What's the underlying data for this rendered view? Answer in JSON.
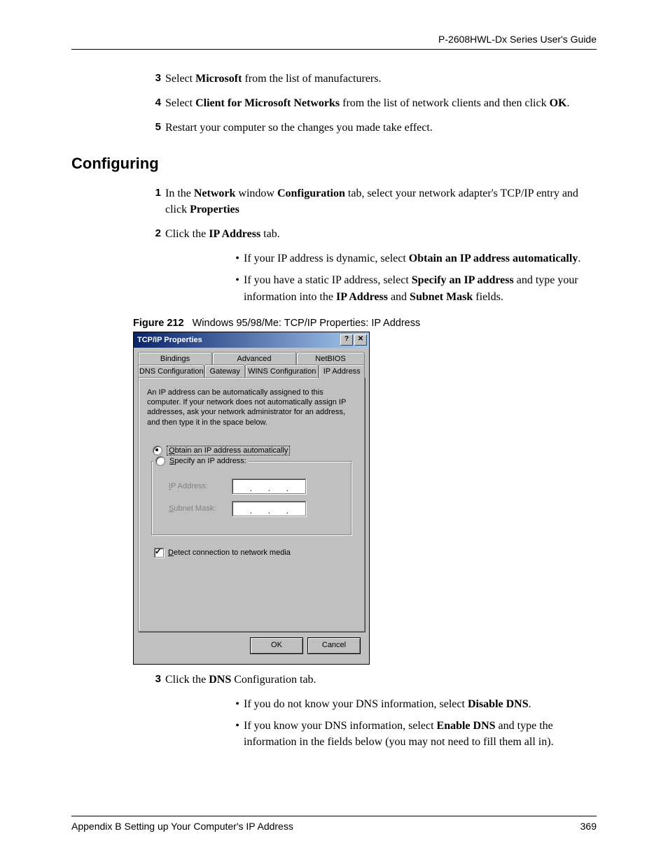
{
  "header": {
    "guide_title": "P-2608HWL-Dx Series User's Guide"
  },
  "steps_top": {
    "s3": {
      "num": "3",
      "pre": "Select ",
      "b1": "Microsoft",
      "post": " from the list of manufacturers."
    },
    "s4": {
      "num": "4",
      "pre": "Select ",
      "b1": "Client for Microsoft Networks",
      "mid": " from the list of network clients and then click ",
      "b2": "OK",
      "post": "."
    },
    "s5": {
      "num": "5",
      "text": "Restart your computer so the changes you made take effect."
    }
  },
  "section_title": "Configuring",
  "steps_cfg": {
    "s1": {
      "num": "1",
      "pre": "In the ",
      "b1": "Network",
      "mid1": " window ",
      "b2": "Configuration",
      "mid2": " tab, select your network adapter's TCP/IP entry and click ",
      "b3": "Properties"
    },
    "s2": {
      "num": "2",
      "pre": "Click the ",
      "b1": "IP Address",
      "post": " tab."
    },
    "s3": {
      "num": "3",
      "pre": "Click the ",
      "b1": "DNS",
      "post": " Configuration tab."
    }
  },
  "bullets1": {
    "b1": {
      "pre": "If your IP address is dynamic, select ",
      "bold": "Obtain an IP address automatically",
      "post": "."
    },
    "b2": {
      "pre": "If you have a static IP address, select ",
      "bold1": "Specify an IP address",
      "mid": " and type your information into the ",
      "bold2": "IP Address",
      "mid2": " and ",
      "bold3": "Subnet Mask",
      "post": " fields."
    }
  },
  "bullets2": {
    "b1": {
      "pre": "If you do not know your DNS information, select ",
      "bold": "Disable DNS",
      "post": "."
    },
    "b2": {
      "pre": "If you know your DNS information, select ",
      "bold": "Enable DNS",
      "post": " and type the information in the fields below (you may not need to fill them all in)."
    }
  },
  "figure": {
    "label": "Figure 212",
    "caption": "Windows 95/98/Me: TCP/IP Properties: IP Address"
  },
  "dialog": {
    "title": "TCP/IP Properties",
    "help_btn": "?",
    "close_btn": "✕",
    "tabs_row1": {
      "bindings": "Bindings",
      "advanced": "Advanced",
      "netbios": "NetBIOS"
    },
    "tabs_row2": {
      "dns": "DNS Configuration",
      "gateway": "Gateway",
      "wins": "WINS Configuration",
      "ip": "IP Address"
    },
    "desc": "An IP address can be automatically assigned to this computer. If your network does not automatically assign IP addresses, ask your network administrator for an address, and then type it in the space below.",
    "radio_auto_pre": "O",
    "radio_auto_rest": "btain an IP address automatically",
    "radio_spec_pre": "S",
    "radio_spec_rest": "pecify an IP address:",
    "ip_label_pre": "I",
    "ip_label_rest": "P Address:",
    "mask_label_pre": "S",
    "mask_label_rest": "ubnet Mask:",
    "detect_pre": "D",
    "detect_rest": "etect connection to network media",
    "ok": "OK",
    "cancel": "Cancel"
  },
  "footer": {
    "appendix": "Appendix B Setting up Your Computer's IP Address",
    "page": "369"
  }
}
